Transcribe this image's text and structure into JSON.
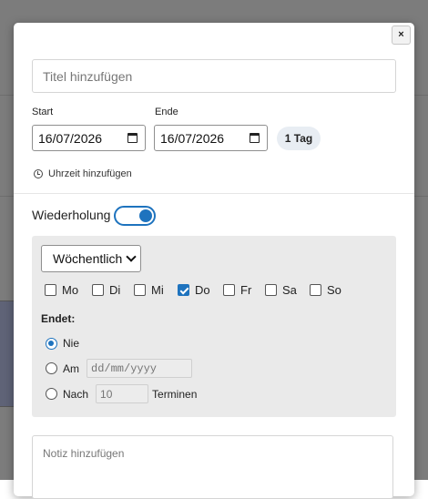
{
  "modal": {
    "close_label": "×"
  },
  "event": {
    "title_placeholder": "Titel hinzufügen",
    "start_label": "Start",
    "start_value": "16/07/2026",
    "end_label": "Ende",
    "end_value": "16/07/2026",
    "duration_badge": "1 Tag",
    "add_time_label": "Uhrzeit hinzufügen"
  },
  "recurrence": {
    "label": "Wiederholung",
    "enabled": true,
    "frequency": "Wöchentlich",
    "weekdays": [
      {
        "label": "Mo",
        "checked": false
      },
      {
        "label": "Di",
        "checked": false
      },
      {
        "label": "Mi",
        "checked": false
      },
      {
        "label": "Do",
        "checked": true
      },
      {
        "label": "Fr",
        "checked": false
      },
      {
        "label": "Sa",
        "checked": false
      },
      {
        "label": "So",
        "checked": false
      }
    ],
    "ends_label": "Endet:",
    "end_options": {
      "never": "Nie",
      "on": "Am",
      "after": "Nach"
    },
    "selected_end_option": "never",
    "on_date_placeholder": "dd/mm/yyyy",
    "after_count_placeholder": "10",
    "after_suffix": "Terminen"
  },
  "note": {
    "placeholder": "Notiz hinzufügen"
  },
  "colors": {
    "accent": "#1e73be",
    "backdrop": "#7c7c7c",
    "panel": "#eaeaea"
  },
  "icons": {
    "close": "close-icon",
    "calendar": "calendar-icon",
    "clock": "clock-icon",
    "dropdown": "chevron-down-icon"
  }
}
